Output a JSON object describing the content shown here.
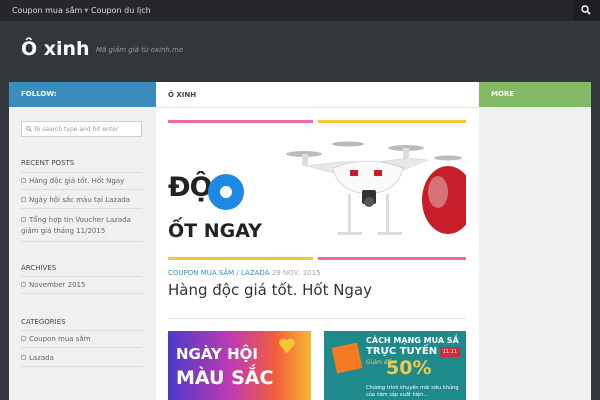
{
  "topnav": {
    "items": [
      {
        "label": "Coupon mua sắm",
        "has_dropdown": true
      },
      {
        "label": "Coupon du lịch",
        "has_dropdown": false
      }
    ],
    "search_icon": "search-icon"
  },
  "header": {
    "title": "Ô xinh",
    "description": "Mã giảm giá từ oxinh.me"
  },
  "sidebar_left": {
    "follow_label": "FOLLOW:",
    "search_placeholder": "To search type and hit enter",
    "recent_posts": {
      "title": "RECENT POSTS",
      "items": [
        "Hàng độc giá tốt. Hốt Ngay",
        "Ngày hội sắc màu tại Lazada",
        "Tổng hợp tin Voucher Lazada giảm giá tháng 11/2015"
      ]
    },
    "archives": {
      "title": "ARCHIVES",
      "items": [
        "November 2015"
      ]
    },
    "categories": {
      "title": "CATEGORIES",
      "items": [
        "Coupon mua sắm",
        "Lazada"
      ]
    }
  },
  "main": {
    "heading": "Ô XINH",
    "featured": {
      "banner_text_top": "ĐỘC",
      "banner_text_bottom": "ỐT NGAY",
      "categories": [
        "COUPON MUA SẮM",
        "LAZADA"
      ],
      "separator": "/",
      "date": "29 NOV, 2015",
      "title": "Hàng độc giá tốt. Hốt Ngay"
    },
    "thumbs": [
      {
        "line1": "NGÀY HỘI",
        "line2": "MÀU SẮC"
      },
      {
        "line1": "CÁCH MẠNG MUA SẮ",
        "line2": "TRỰC TUYẾN",
        "tag": "11.11",
        "prefix": "Giảm đến",
        "discount": "50%",
        "note1": "Chương trình khuyến mãi siêu khủng",
        "note2": "của năm sắp xuất hiện..."
      }
    ]
  },
  "sidebar_right": {
    "more_label": "MORE"
  },
  "colors": {
    "follow_bar": "#3b8dbd",
    "more_bar": "#82b965",
    "header_bg": "#33363b",
    "topnav_bg": "#26272b"
  }
}
